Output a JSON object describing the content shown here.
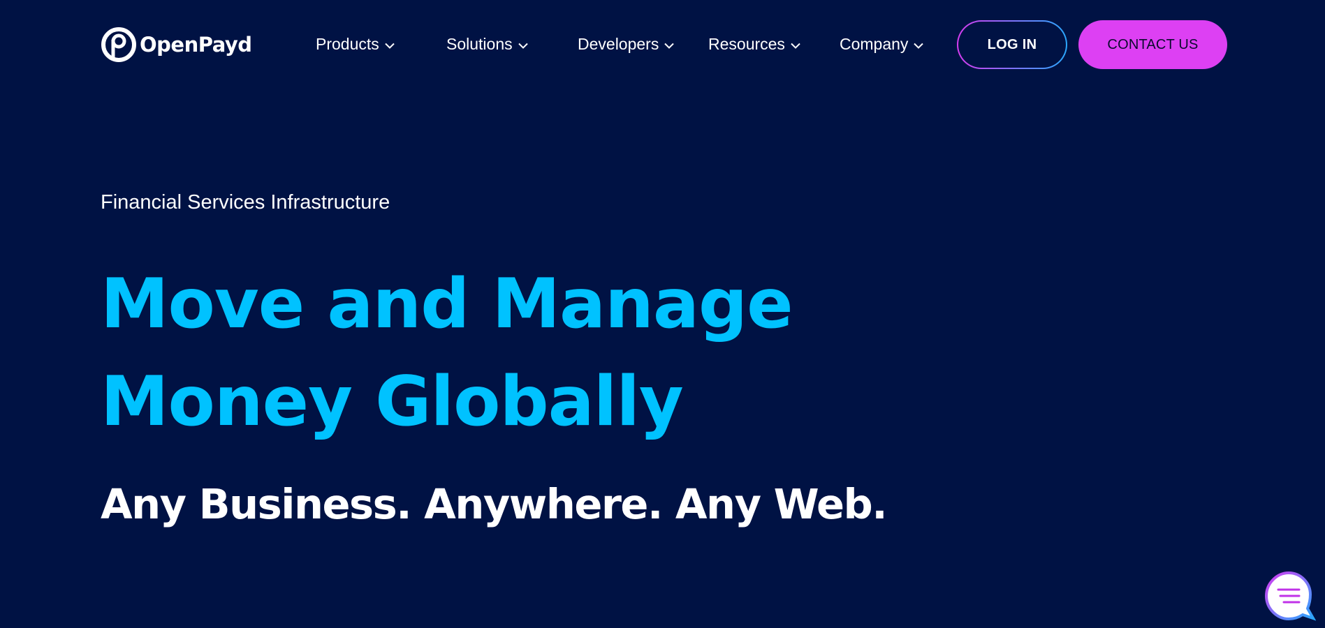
{
  "header": {
    "logo_text": "OpenPayd",
    "nav": [
      {
        "label": "Products"
      },
      {
        "label": "Solutions"
      },
      {
        "label": "Developers"
      },
      {
        "label": "Resources"
      },
      {
        "label": "Company"
      }
    ],
    "login_label": "LOG IN",
    "contact_label": "CONTACT US"
  },
  "hero": {
    "eyebrow": "Financial Services Infrastructure",
    "headline_line1": "Move and Manage",
    "headline_line2": "Money Globally",
    "tagline": "Any Business. Anywhere. Any Web."
  },
  "colors": {
    "background": "#001244",
    "accent_cyan": "#00c2ff",
    "accent_magenta": "#dd40f3",
    "gradient_blue": "#2aa8ff"
  },
  "icons": {
    "logo": "openpayd-logo-icon",
    "nav_chevron": "chevron-down-icon",
    "chat": "chat-bubble-icon"
  }
}
